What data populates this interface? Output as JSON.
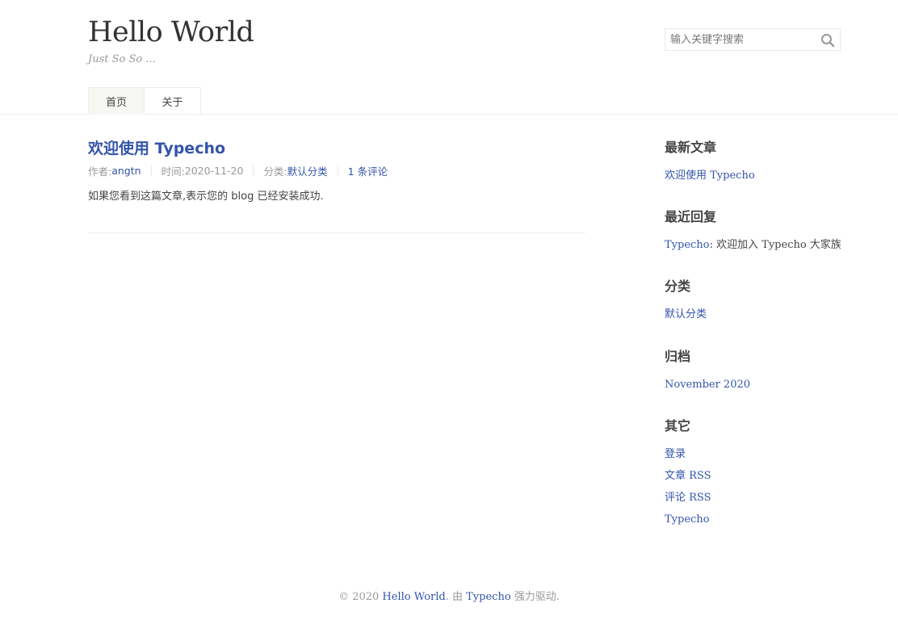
{
  "header": {
    "site_title": "Hello World",
    "site_description": "Just So So ..."
  },
  "search": {
    "placeholder": "输入关键字搜索",
    "icon": "search-icon"
  },
  "nav": {
    "items": [
      {
        "label": "首页",
        "current": true
      },
      {
        "label": "关于",
        "current": false
      }
    ]
  },
  "post": {
    "title": "欢迎使用 Typecho",
    "meta": {
      "author_label": "作者: ",
      "author": "angtn",
      "time_label": "时间: ",
      "time": "2020-11-20",
      "category_label": "分类: ",
      "category": "默认分类",
      "comments": "1 条评论"
    },
    "content": "如果您看到这篇文章,表示您的 blog 已经安装成功."
  },
  "sidebar": {
    "recent_posts": {
      "title": "最新文章",
      "items": [
        "欢迎使用 Typecho"
      ]
    },
    "recent_comments": {
      "title": "最近回复",
      "items": [
        {
          "author": "Typecho",
          "text": ": 欢迎加入 Typecho 大家族"
        }
      ]
    },
    "categories": {
      "title": "分类",
      "items": [
        "默认分类"
      ]
    },
    "archives": {
      "title": "归档",
      "items": [
        "November 2020"
      ]
    },
    "other": {
      "title": "其它",
      "items": [
        "登录",
        "文章 RSS",
        "评论 RSS",
        "Typecho"
      ]
    }
  },
  "footer": {
    "prefix": "© 2020 ",
    "site_link": "Hello World",
    "middle": ". 由 ",
    "powered_link": "Typecho",
    "suffix": " 强力驱动."
  },
  "colors": {
    "link": "#3354AA",
    "text": "#444444",
    "muted": "#999999",
    "border": "#EEEEEE"
  }
}
